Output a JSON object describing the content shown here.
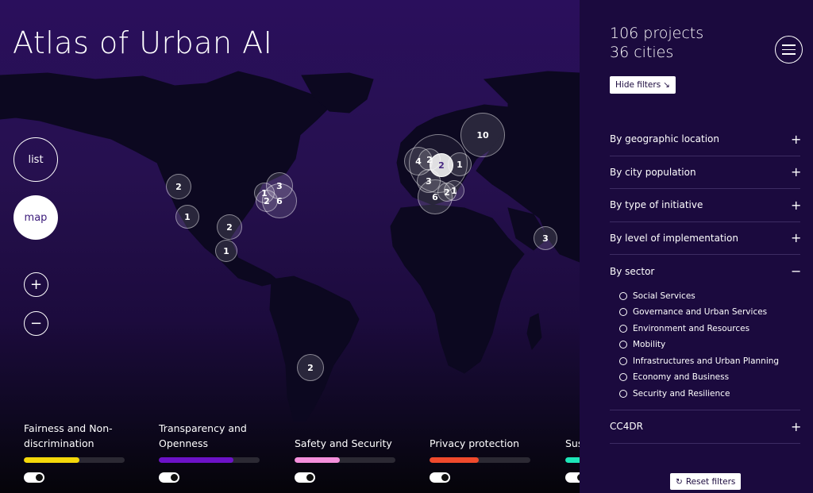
{
  "app": {
    "title": "Atlas of Urban AI"
  },
  "view_controls": {
    "list_label": "list",
    "map_label": "map",
    "zoom_in_label": "+",
    "zoom_out_label": "−"
  },
  "clusters": [
    {
      "count": "2"
    },
    {
      "count": "1"
    },
    {
      "count": "2"
    },
    {
      "count": "1"
    },
    {
      "count": "3"
    },
    {
      "count": "1"
    },
    {
      "count": "2"
    },
    {
      "count": "6"
    },
    {
      "count": "4"
    },
    {
      "count": "2"
    },
    {
      "count": "1"
    },
    {
      "count": "10"
    },
    {
      "count": "3"
    },
    {
      "count": "6"
    },
    {
      "count": "2"
    },
    {
      "count": "1"
    },
    {
      "count": "2"
    },
    {
      "count": "3"
    }
  ],
  "values": [
    {
      "label": "Fairness and Non-discrimination",
      "color": "#f4d80a",
      "progress": 0.55
    },
    {
      "label": "Transparency and Openness",
      "color": "#6c12c8",
      "progress": 0.74
    },
    {
      "label": "Safety and Security",
      "color": "#f48fdc",
      "progress": 0.45
    },
    {
      "label": "Privacy protection",
      "color": "#f04a2c",
      "progress": 0.49
    },
    {
      "label": "Sus",
      "color": "#1de6b8",
      "progress": 0.3
    }
  ],
  "panel": {
    "projects": "106 projects",
    "cities": "36 cities",
    "hide_filters_label": "Hide filters",
    "hide_filters_icon": "↘",
    "filters": [
      {
        "label": "By geographic location",
        "sign": "+"
      },
      {
        "label": "By city population",
        "sign": "+"
      },
      {
        "label": "By type of initiative",
        "sign": "+"
      },
      {
        "label": "By level of implementation",
        "sign": "+"
      }
    ],
    "sector": {
      "label": "By sector",
      "sign": "−",
      "options": [
        "Social Services",
        "Governance and Urban Services",
        "Environment and Resources",
        "Mobility",
        "Infrastructures and Urban Planning",
        "Economy and Business",
        "Security and Resilience"
      ]
    },
    "cc4dr": {
      "label": "CC4DR",
      "sign": "+"
    },
    "reset_label": "Reset filters",
    "reset_icon": "↻"
  }
}
